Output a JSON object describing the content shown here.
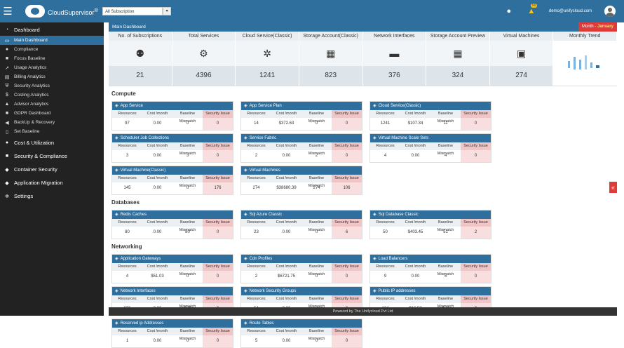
{
  "app": {
    "name": "CloudSupervisor",
    "trademark": "®"
  },
  "subscription": {
    "value": "All Subscription",
    "dropdown_icon": "chevron-down-icon"
  },
  "topbar": {
    "notification_count": "50",
    "user_email": "demo@unifycloud.com"
  },
  "sidebar": {
    "sections": [
      {
        "label": "Dashboard",
        "icon": "dashboard-icon",
        "items": [
          {
            "label": "Main Dashboard",
            "active": true
          },
          {
            "label": "Compliance"
          },
          {
            "label": "Focus Baseline"
          },
          {
            "label": "Usage Analytics"
          },
          {
            "label": "Billing Analytics"
          },
          {
            "label": "Security Analytics"
          },
          {
            "label": "Costing Analytics"
          },
          {
            "label": "Advisor Analytics"
          },
          {
            "label": "GDPR Dashboard"
          },
          {
            "label": "BackUp & Recovery"
          },
          {
            "label": "Set Baseline"
          }
        ]
      },
      {
        "label": "Cost & Utilization"
      },
      {
        "label": "Security & Compliance"
      },
      {
        "label": "Container Security"
      },
      {
        "label": "Application Migration"
      },
      {
        "label": "Settings"
      }
    ]
  },
  "main": {
    "title": "Main Dashboard",
    "month_prefix": "Month - ",
    "month": "January"
  },
  "stats": [
    {
      "label": "No. of Subscriptions",
      "value": "21"
    },
    {
      "label": "Total Services",
      "value": "4396"
    },
    {
      "label": "Cloud Service(Classic)",
      "value": "1241"
    },
    {
      "label": "Storage Account(Classic)",
      "value": "823"
    },
    {
      "label": "Network Interfaces",
      "value": "376"
    },
    {
      "label": "Storage Account Preview",
      "value": "324"
    },
    {
      "label": "Virtual Machines",
      "value": "274"
    },
    {
      "label": "Monthly Trend"
    }
  ],
  "columns": [
    "Resources",
    "Cost /month",
    "Baseline Mismatch",
    "Security Issue"
  ],
  "sections": [
    {
      "title": "Compute",
      "cards": [
        {
          "title": "App Service",
          "resources": "97",
          "cost": "0.00",
          "baseline": "0",
          "security": "0"
        },
        {
          "title": "App Service Plan",
          "resources": "14",
          "cost": "$372.63",
          "baseline": "0",
          "security": "0"
        },
        {
          "title": "Cloud Service(Classic)",
          "resources": "1241",
          "cost": "$107.34",
          "baseline": "11",
          "security": "0"
        },
        {
          "title": "Scheduler Job Collections",
          "resources": "3",
          "cost": "0.00",
          "baseline": "3",
          "security": "0"
        },
        {
          "title": "Service Fabric",
          "resources": "2",
          "cost": "0.00",
          "baseline": "2",
          "security": "0"
        },
        {
          "title": "Virtual Machine Scale Sets",
          "resources": "4",
          "cost": "0.00",
          "baseline": "4",
          "security": "0"
        },
        {
          "title": "Virtual Machine(Classic)",
          "resources": "145",
          "cost": "0.00",
          "baseline": "0",
          "security": "176"
        },
        {
          "title": "Virtual Machines",
          "resources": "274",
          "cost": "$38680.39",
          "baseline": "274",
          "security": "106"
        }
      ]
    },
    {
      "title": "Databases",
      "cards": [
        {
          "title": "Redis Caches",
          "resources": "80",
          "cost": "0.00",
          "baseline": "80",
          "security": "0"
        },
        {
          "title": "Sql Azure Classic",
          "resources": "23",
          "cost": "0.00",
          "baseline": "0",
          "security": "6"
        },
        {
          "title": "Sql Database Classic",
          "resources": "50",
          "cost": "$403.45",
          "baseline": "51",
          "security": "2"
        }
      ]
    },
    {
      "title": "Networking",
      "cards": [
        {
          "title": "Application Gateways",
          "resources": "4",
          "cost": "$51.03",
          "baseline": "0",
          "security": "0"
        },
        {
          "title": "Cdn Profiles",
          "resources": "2",
          "cost": "$6721.75",
          "baseline": "0",
          "security": "0"
        },
        {
          "title": "Load Balancers",
          "resources": "9",
          "cost": "0.00",
          "baseline": "5",
          "security": "0"
        },
        {
          "title": "Network Interfaces",
          "resources": "376",
          "cost": "0.00",
          "baseline": "376",
          "security": "0"
        },
        {
          "title": "Network Security Groups",
          "resources": "54",
          "cost": "0.00",
          "baseline": "0",
          "security": "0"
        },
        {
          "title": "Public IP addresses",
          "resources": "124",
          "cost": "$10.53",
          "baseline": "124",
          "security": "0"
        },
        {
          "title": "Reserved ip Addresses",
          "resources": "1",
          "cost": "0.00",
          "baseline": "0",
          "security": "0"
        },
        {
          "title": "Route Tables",
          "resources": "5",
          "cost": "0.00",
          "baseline": "0",
          "security": "0"
        }
      ]
    }
  ],
  "footer": "Powered by The Unifycloud Pvt Ltd",
  "colors": {
    "brand": "#2e6f9e",
    "alert": "#e03b3b",
    "sidebar": "#222222"
  }
}
